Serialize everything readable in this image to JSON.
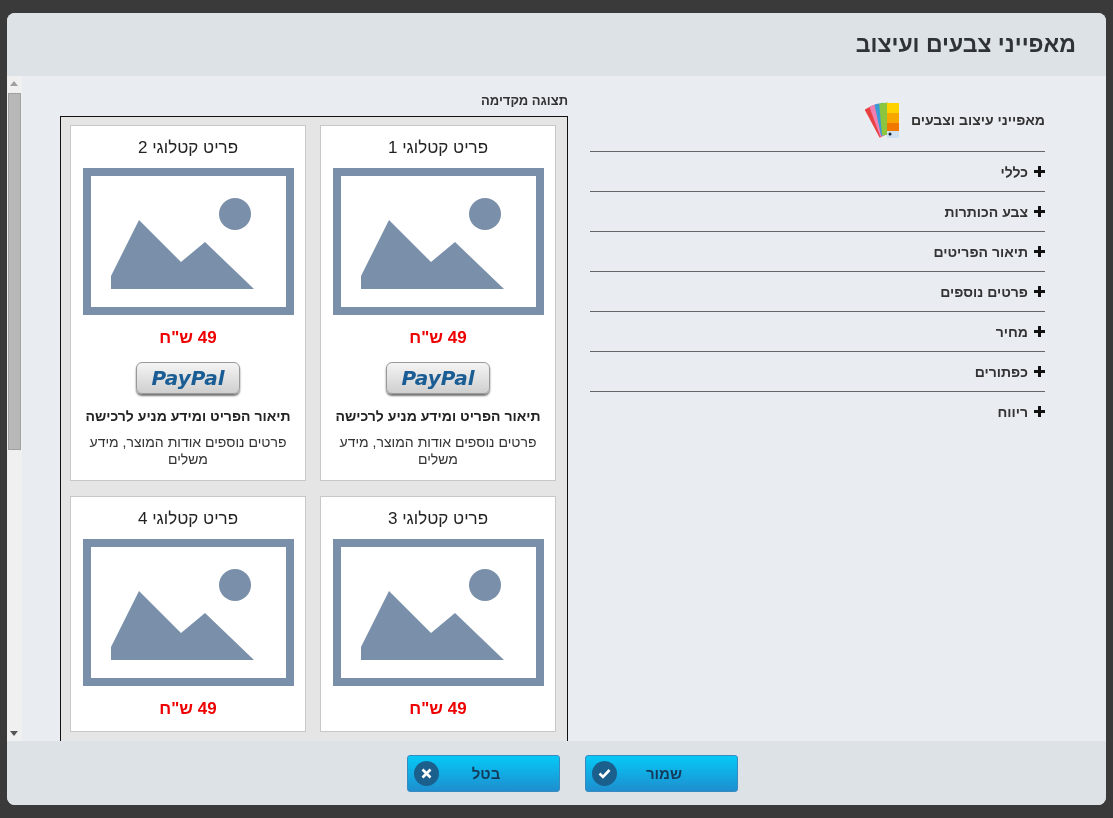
{
  "dialog": {
    "title": "מאפייני צבעים ועיצוב"
  },
  "preview": {
    "label": "תצוגה מקדימה",
    "items": [
      {
        "title": "פריט קטלוגי 1",
        "price": "49 ש\"ח",
        "button": "PayPal",
        "description": "תיאור הפריט ומידע מניע לרכישה",
        "details": "פרטים נוספים אודות המוצר, מידע משלים"
      },
      {
        "title": "פריט קטלוגי 2",
        "price": "49 ש\"ח",
        "button": "PayPal",
        "description": "תיאור הפריט ומידע מניע לרכישה",
        "details": "פרטים נוספים אודות המוצר, מידע משלים"
      },
      {
        "title": "פריט קטלוגי 3",
        "price": "49 ש\"ח"
      },
      {
        "title": "פריט קטלוגי 4",
        "price": "49 ש\"ח"
      }
    ]
  },
  "settings": {
    "heading": "מאפייני עיצוב וצבעים",
    "sections": [
      {
        "label": "כללי",
        "expanded": false
      },
      {
        "label": "צבע הכותרות",
        "expanded": false
      },
      {
        "label": "תיאור הפריטים",
        "expanded": false
      },
      {
        "label": "פרטים נוספים",
        "expanded": false
      },
      {
        "label": "מחיר",
        "expanded": false
      },
      {
        "label": "כפתורים",
        "expanded": false
      },
      {
        "label": "ריווח",
        "expanded": false
      }
    ]
  },
  "buttons": [
    {
      "label": "שמור",
      "kind": "save"
    },
    {
      "label": "בטל",
      "kind": "cancel"
    }
  ]
}
